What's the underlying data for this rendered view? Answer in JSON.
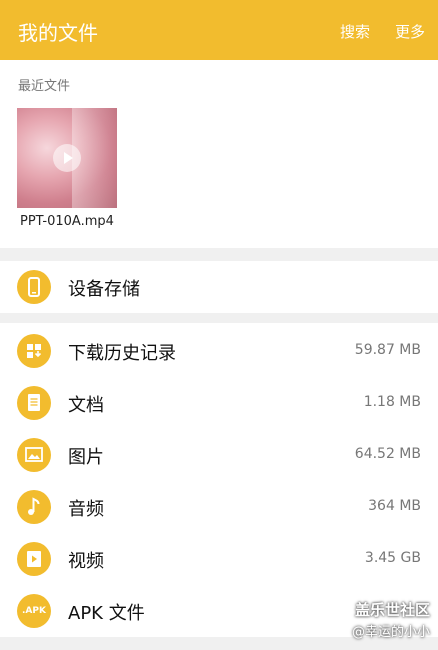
{
  "appbar": {
    "title": "我的文件",
    "search_label": "搜索",
    "more_label": "更多"
  },
  "recent": {
    "section_label": "最近文件",
    "files": [
      {
        "name": "PPT-010A.mp4"
      }
    ]
  },
  "storage": {
    "label": "设备存储",
    "icon": "phone-icon"
  },
  "categories": [
    {
      "label": "下载历史记录",
      "size": "59.87 MB",
      "icon": "download-history-icon"
    },
    {
      "label": "文档",
      "size": "1.18 MB",
      "icon": "document-icon"
    },
    {
      "label": "图片",
      "size": "64.52 MB",
      "icon": "image-icon"
    },
    {
      "label": "音频",
      "size": "364 MB",
      "icon": "music-note-icon"
    },
    {
      "label": "视频",
      "size": "3.45 GB",
      "icon": "video-icon"
    },
    {
      "label": "APK 文件",
      "size": "",
      "icon": "apk-icon",
      "icon_text": ".APK"
    }
  ],
  "watermark": {
    "line1": "盖乐世社区",
    "line2": "@幸运的小小"
  },
  "colors": {
    "accent": "#f2bc2e",
    "background": "#f0f0f0"
  }
}
